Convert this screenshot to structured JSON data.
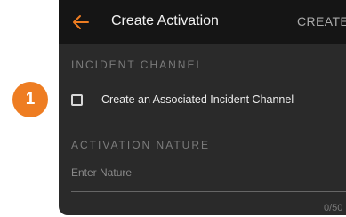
{
  "annotation": {
    "step_number": "1",
    "badge_color": "#ee7d22"
  },
  "app_bar": {
    "back_icon": "arrow-left-icon",
    "title": "Create Activation",
    "action_label": "CREATE"
  },
  "incident_channel": {
    "section_label": "INCIDENT CHANNEL",
    "checkbox_label": "Create an Associated Incident Channel",
    "checked": false
  },
  "activation_nature": {
    "section_label": "ACTIVATION NATURE",
    "input_value": "",
    "input_placeholder": "Enter Nature",
    "char_counter": "0/50"
  },
  "colors": {
    "accent": "#ee7d22",
    "background": "#2a2a2a",
    "app_bar": "#151515"
  }
}
